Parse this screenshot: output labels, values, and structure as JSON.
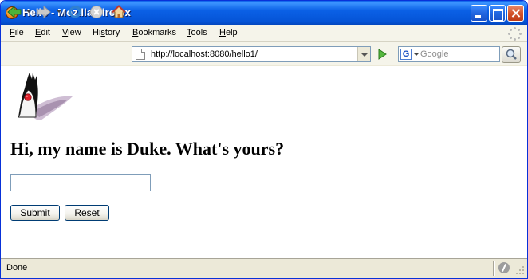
{
  "window": {
    "title": "Hello - Mozilla Firefox"
  },
  "menu": {
    "items": [
      {
        "accel": "F",
        "rest": "ile"
      },
      {
        "accel": "E",
        "rest": "dit"
      },
      {
        "accel": "V",
        "rest": "iew"
      },
      {
        "pre": "Hi",
        "accel": "s",
        "rest": "tory"
      },
      {
        "accel": "B",
        "rest": "ookmarks"
      },
      {
        "accel": "T",
        "rest": "ools"
      },
      {
        "accel": "H",
        "rest": "elp"
      }
    ]
  },
  "navbar": {
    "url": "http://localhost:8080/hello1/",
    "search_engine_letter": "G",
    "search_placeholder": "Google"
  },
  "page": {
    "heading": "Hi, my name is Duke. What's yours?",
    "name_value": "",
    "submit_label": "Submit",
    "reset_label": "Reset"
  },
  "status": {
    "text": "Done"
  },
  "colors": {
    "titlebar": "#0553d6",
    "chrome": "#ece9d8",
    "field_border": "#7f9db9",
    "button_border": "#003c74",
    "duke_red": "#e0202a"
  },
  "icons": [
    "firefox-icon",
    "back-icon",
    "forward-icon",
    "reload-icon",
    "stop-icon",
    "home-icon",
    "page-icon",
    "go-icon",
    "google-icon",
    "magnifier-icon",
    "duke-mascot",
    "throbber-icon",
    "status-icon"
  ]
}
